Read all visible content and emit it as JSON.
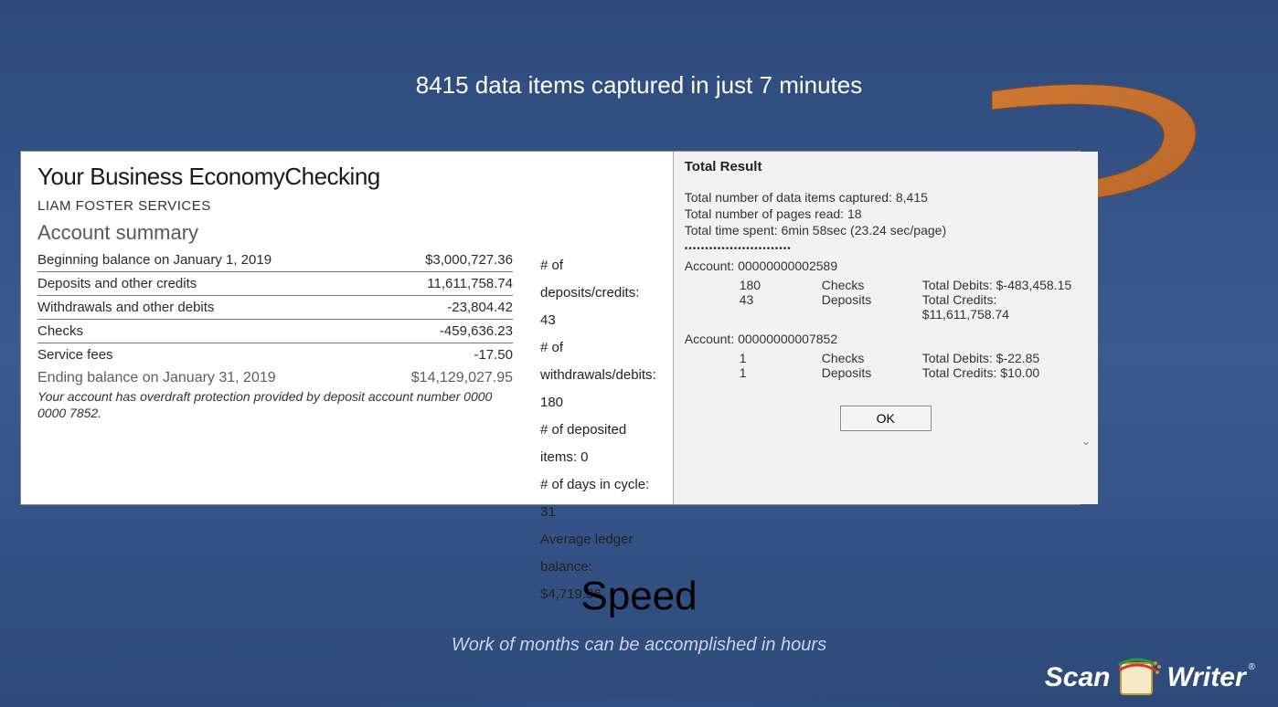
{
  "headline": "8415 data items captured in just 7 minutes",
  "statement": {
    "title": "Your Business EconomyChecking",
    "account_name": "LIAM FOSTER SERVICES",
    "summary_heading": "Account summary",
    "rows": [
      {
        "label": "Beginning balance on January 1, 2019",
        "value": "$3,000,727.36"
      },
      {
        "label": "Deposits and other credits",
        "value": "11,611,758.74"
      },
      {
        "label": "Withdrawals and other debits",
        "value": "-23,804.42"
      },
      {
        "label": "Checks",
        "value": "-459,636.23"
      },
      {
        "label": "Service fees",
        "value": "-17.50"
      }
    ],
    "ending_label": "Ending balance on January 31, 2019",
    "ending_value": "$14,129,027.95",
    "footnote": "Your account has overdraft protection provided by  deposit  account  number 0000 0000 7852.",
    "side_stats": {
      "deposits_credits": "# of deposits/credits: 43",
      "withdrawals_debits": "# of withdrawals/debits: 180",
      "deposited_items": "# of deposited items: 0",
      "days_in_cycle": "# of days in cycle: 31",
      "avg_ledger": "Average ledger balance: $4,719.36"
    }
  },
  "result_panel": {
    "title": "Total Result",
    "line1": "Total number of data items captured: 8,415",
    "line2": "Total number of pages read: 18",
    "line3": "Total time spent: 6min 58sec (23.24 sec/page)",
    "acct1": {
      "header": "Account: 00000000002589",
      "r1c1": "180",
      "r1c2": "Checks",
      "r1c3": "Total Debits: $-483,458.15",
      "r2c1": "43",
      "r2c2": "Deposits",
      "r2c3": "Total Credits: $11,611,758.74"
    },
    "acct2": {
      "header": "Account: 00000000007852",
      "r1c1": "1",
      "r1c2": "Checks",
      "r1c3": "Total Debits: $-22.85",
      "r2c1": "1",
      "r2c2": "Deposits",
      "r2c3": "Total Credits: $10.00"
    },
    "ok": "OK"
  },
  "footer": {
    "title": "Speed",
    "subtitle": "Work of months can be accomplished in hours"
  },
  "logo": {
    "left": "Scan",
    "right": "Writer"
  }
}
